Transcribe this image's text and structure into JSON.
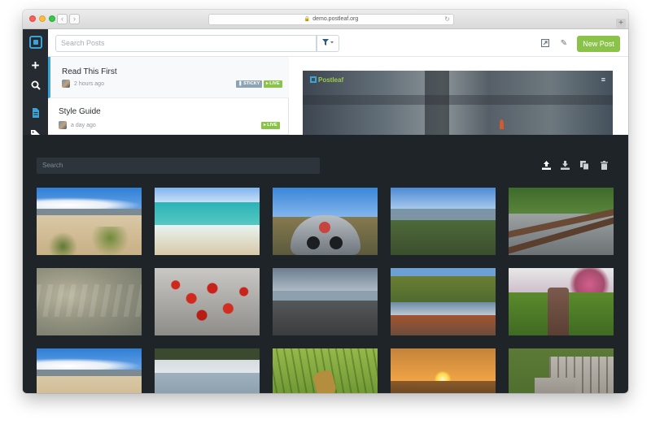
{
  "browser": {
    "url": "demo.postleaf.org",
    "back_glyph": "‹",
    "forward_glyph": "›",
    "lock_glyph": "🔒",
    "reload_glyph": "↻",
    "newtab_glyph": "+"
  },
  "sidebar": {
    "items": [
      {
        "icon": "logo-icon"
      },
      {
        "icon": "plus-icon",
        "glyph": "+"
      },
      {
        "icon": "search-icon",
        "glyph": "🔍"
      },
      {
        "icon": "document-icon",
        "glyph": "🗎"
      },
      {
        "icon": "tag-icon",
        "glyph": "🏷"
      }
    ]
  },
  "toolbar": {
    "search_placeholder": "Search Posts",
    "filter_glyph": "▼ ▾",
    "icons": [
      "open-icon",
      "edit-icon",
      "trash-icon"
    ],
    "open_glyph": "⇱",
    "edit_glyph": "✎",
    "trash_glyph": "🗑",
    "new_post_label": "New Post"
  },
  "posts": [
    {
      "title": "Read This First",
      "time": "2 hours ago",
      "badges": [
        "STICKY",
        "LIVE"
      ]
    },
    {
      "title": "Style Guide",
      "time": "a day ago",
      "badges": [
        "LIVE"
      ]
    }
  ],
  "badge_glyphs": {
    "sticky": "❚ STICKY",
    "live": "▸ LIVE"
  },
  "preview": {
    "logo_text": "Postleaf",
    "menu_glyph": "≡"
  },
  "media": {
    "search_placeholder": "Search",
    "upload_glyph": "⤒",
    "download_glyph": "⤓",
    "copy_glyph": "⧉",
    "trash_glyph": "🗑",
    "thumbnails": [
      "desert-with-blue-sky",
      "ocean-waves",
      "coin-operated-binoculars",
      "mountain-valley",
      "railroad-track",
      "clear-shallow-water",
      "red-berries-with-snow",
      "rocky-mountain-summit",
      "river-with-autumn-trees",
      "tree-stump-in-meadow",
      "desert-with-blue-sky",
      "lake-shore-with-trees",
      "grasshopper-on-grass",
      "sunset-over-water",
      "wooden-crates-on-grass"
    ]
  },
  "colors": {
    "accent": "#3aa3d8",
    "new_post": "#8bc34a",
    "live_badge": "#8bc34a",
    "sticky_badge": "#8ea3b3",
    "overlay_bg": "#1f2429",
    "sidebar_bg": "#252b31"
  }
}
